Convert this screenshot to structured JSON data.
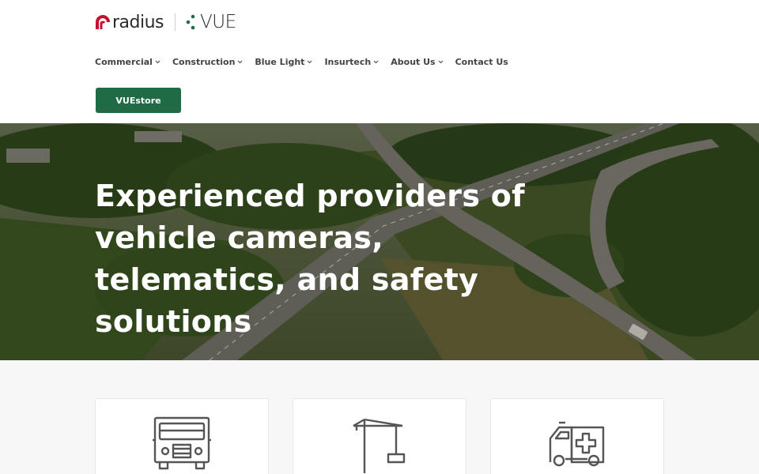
{
  "brand": {
    "radius_logo_text": "radius",
    "vue_logo_text": "VUE",
    "accent_red": "#c8102e",
    "accent_green": "#1e6b45"
  },
  "nav": {
    "items": [
      {
        "label": "Commercial",
        "has_dropdown": true
      },
      {
        "label": "Construction",
        "has_dropdown": true
      },
      {
        "label": "Blue Light",
        "has_dropdown": true
      },
      {
        "label": "Insurtech",
        "has_dropdown": true
      },
      {
        "label": "About Us",
        "has_dropdown": true
      },
      {
        "label": "Contact Us",
        "has_dropdown": false
      }
    ]
  },
  "store_button": {
    "label": "VUEstore"
  },
  "hero": {
    "title": "Experienced providers of vehicle cameras, telematics, and safety solutions"
  },
  "cards": [
    {
      "icon": "truck-icon"
    },
    {
      "icon": "crane-icon"
    },
    {
      "icon": "ambulance-icon"
    }
  ]
}
